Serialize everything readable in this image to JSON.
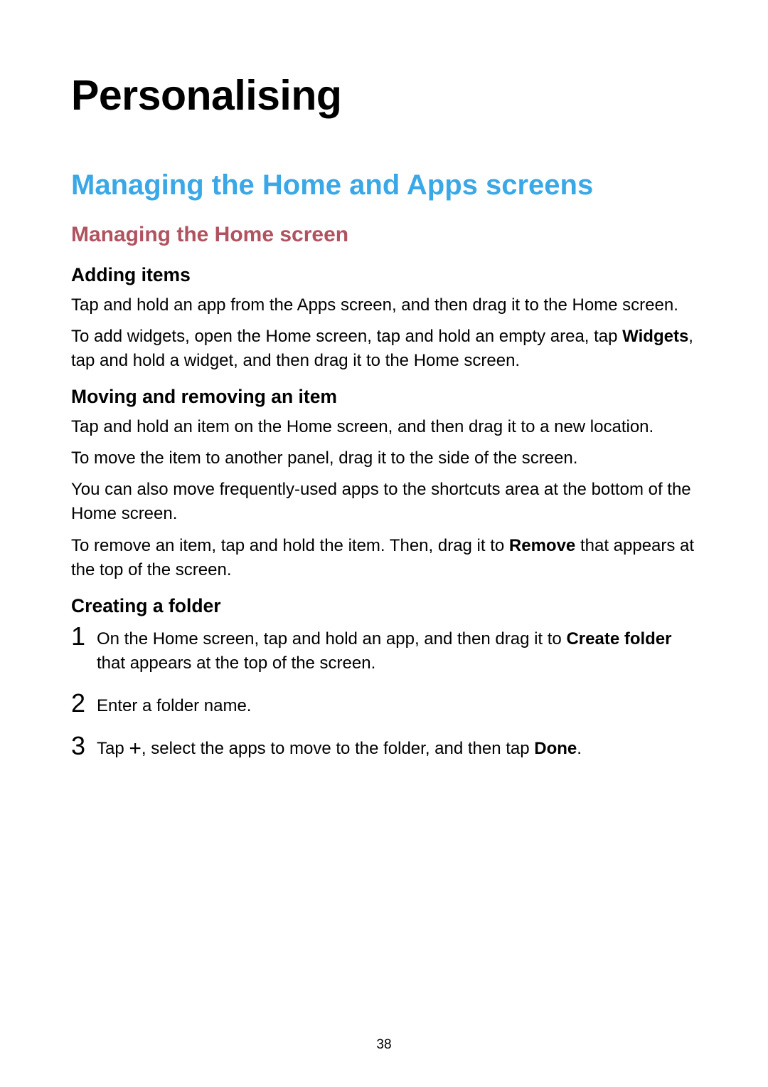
{
  "title": "Personalising",
  "section_title": "Managing the Home and Apps screens",
  "subsection_title": "Managing the Home screen",
  "adding_items": {
    "heading": "Adding items",
    "p1": "Tap and hold an app from the Apps screen, and then drag it to the Home screen.",
    "p2_a": "To add widgets, open the Home screen, tap and hold an empty area, tap ",
    "p2_bold": "Widgets",
    "p2_b": ", tap and hold a widget, and then drag it to the Home screen."
  },
  "moving_items": {
    "heading": "Moving and removing an item",
    "p1": "Tap and hold an item on the Home screen, and then drag it to a new location.",
    "p2": "To move the item to another panel, drag it to the side of the screen.",
    "p3": "You can also move frequently-used apps to the shortcuts area at the bottom of the Home screen.",
    "p4_a": "To remove an item, tap and hold the item. Then, drag it to ",
    "p4_bold": "Remove",
    "p4_b": " that appears at the top of the screen."
  },
  "creating_folder": {
    "heading": "Creating a folder",
    "step1_a": "On the Home screen, tap and hold an app, and then drag it to ",
    "step1_bold": "Create folder",
    "step1_b": " that appears at the top of the screen.",
    "step2": "Enter a folder name.",
    "step3_a": "Tap ",
    "step3_b": ", select the apps to move to the folder, and then tap ",
    "step3_bold": "Done",
    "step3_c": "."
  },
  "page_number": "38",
  "step_numbers": {
    "one": "1",
    "two": "2",
    "three": "3"
  }
}
